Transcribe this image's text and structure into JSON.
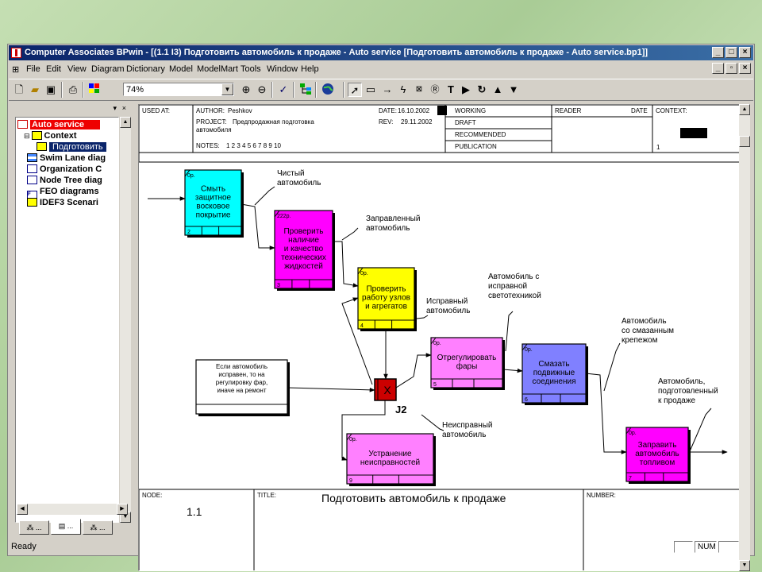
{
  "window": {
    "title": "Computer Associates BPwin - [(1.1 I3) Подготовить автомобиль к продаже - Auto service  [Подготовить автомобиль к продаже - Auto service.bp1]]"
  },
  "menu": [
    "File",
    "Edit",
    "View",
    "Diagram",
    "Dictionary",
    "Model",
    "ModelMart",
    "Tools",
    "Window",
    "Help"
  ],
  "toolbar": {
    "zoom_value": "74%",
    "icons": [
      "new-file",
      "open-folder",
      "save",
      "print",
      "color-palette",
      "zoom-in",
      "zoom-out",
      "spell-check",
      "model-explorer",
      "globe",
      "pointer",
      "uow-box",
      "link",
      "junction",
      "referent",
      "note",
      "text",
      "triangle-play",
      "cycle",
      "triangle-up",
      "triangle-down"
    ]
  },
  "tree": {
    "root": "Auto service",
    "items": [
      {
        "label": "Context",
        "level": 1
      },
      {
        "label": "Подготовить",
        "level": 2,
        "selected": true
      },
      {
        "label": "Swim Lane diag",
        "level": 1
      },
      {
        "label": "Organization C",
        "level": 1
      },
      {
        "label": "Node Tree diag",
        "level": 1
      },
      {
        "label": "FEO diagrams",
        "level": 1
      },
      {
        "label": "IDEF3 Scenari",
        "level": 1
      }
    ],
    "tabs": [
      "tree-tab-1",
      "tree-tab-2",
      "tree-tab-3"
    ],
    "tab_dots": [
      "...",
      "...",
      "..."
    ]
  },
  "frame": {
    "used_at_label": "USED AT:",
    "author_label": "AUTHOR:",
    "author_value": "Peshkov",
    "date_label": "DATE:",
    "date_value": "16.10.2002",
    "rev_label": "REV:",
    "rev_value": "29.11.2002",
    "project_label": "PROJECT:",
    "project_value_1": "Предпродажная подготовка",
    "project_value_2": "автомобиля",
    "notes_label": "NOTES:",
    "notes_value": "1  2  3  4  5  6  7  8  9  10",
    "status_rows": [
      "WORKING",
      "DRAFT",
      "RECOMMENDED",
      "PUBLICATION"
    ],
    "reader_label": "READER",
    "reader_date_label": "DATE",
    "context_label": "CONTEXT:",
    "context_num": "1",
    "node_label": "NODE:",
    "node_value": "1.1",
    "title_label": "TITLE:",
    "title_value": "Подготовить автомобиль к продаже",
    "number_label": "NUMBER:"
  },
  "diagram": {
    "boxes": [
      {
        "id": "2",
        "cost": "0р.",
        "lines": [
          "Смыть",
          "защитное",
          "восковое",
          "покрытие"
        ],
        "color": "#00ffff"
      },
      {
        "id": "3",
        "cost": "222р.",
        "lines": [
          "Проверить",
          "наличие",
          "и качество",
          "технических",
          "жидкостей"
        ],
        "color": "#ff00ff"
      },
      {
        "id": "4",
        "cost": "0р.",
        "lines": [
          "Проверить",
          "работу узлов",
          "и агрегатов"
        ],
        "color": "#ffff00"
      },
      {
        "id": "5",
        "cost": "0р.",
        "lines": [
          "Отрегулировать",
          "фары"
        ],
        "color": "#ff80ff"
      },
      {
        "id": "6",
        "cost": "0р.",
        "lines": [
          "Смазать",
          "подвижные",
          "соединения"
        ],
        "color": "#8080ff"
      },
      {
        "id": "7",
        "cost": "0р.",
        "lines": [
          "Заправить",
          "автомобиль",
          "топливом"
        ],
        "color": "#ff00ff"
      },
      {
        "id": "9",
        "cost": "0р.",
        "lines": [
          "Устранение",
          "неисправностей"
        ],
        "color": "#ff80ff"
      }
    ],
    "referent_lines": [
      "Если автомобиль",
      "исправен, то на",
      "регулировку фар,",
      "иначе на ремонт"
    ],
    "junction_symbol": "X",
    "junction_label": "J2",
    "labels": {
      "clean_car": [
        "Чистый",
        "автомобиль"
      ],
      "fueled_car": [
        "Заправленный",
        "автомобиль"
      ],
      "lights_car": [
        "Автомобиль с",
        "исправной",
        "светотехникой"
      ],
      "working_car": [
        "Исправный",
        "автомобиль"
      ],
      "greased_car": [
        "Автомобиль",
        "со смазанным",
        "крепежом"
      ],
      "ready_car": [
        "Автомобиль,",
        "подготовленный",
        "к продаже"
      ],
      "broken_car": [
        "Неисправный",
        "автомобиль"
      ]
    }
  },
  "status": {
    "ready": "Ready",
    "num": "NUM"
  }
}
